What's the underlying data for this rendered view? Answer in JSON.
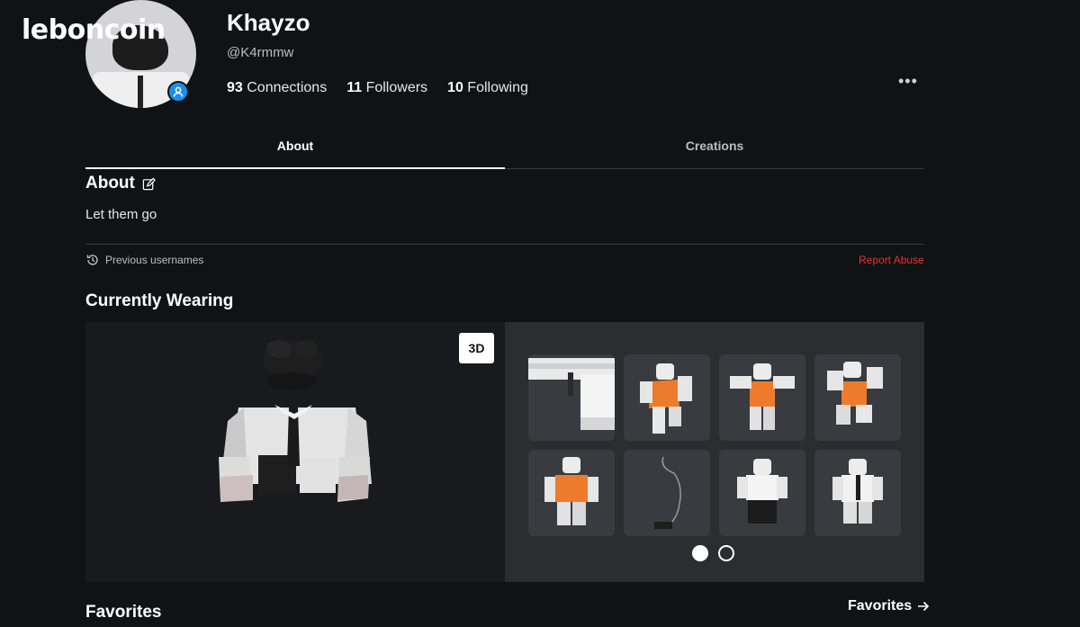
{
  "watermark": "leboncoin",
  "profile": {
    "display_name": "Khayzo",
    "handle": "@K4rmmw",
    "stats": [
      {
        "count": "93",
        "label": "Connections"
      },
      {
        "count": "11",
        "label": "Followers"
      },
      {
        "count": "10",
        "label": "Following"
      }
    ],
    "more_label": "•••"
  },
  "tabs": [
    {
      "label": "About",
      "active": true
    },
    {
      "label": "Creations",
      "active": false
    }
  ],
  "about": {
    "title": "About",
    "bio": "Let them go",
    "previous_usernames": "Previous usernames",
    "report": "Report Abuse"
  },
  "wearing": {
    "title": "Currently Wearing",
    "view_toggle": "3D",
    "items": [
      {
        "icon": "shirt-collar-item-icon"
      },
      {
        "icon": "orange-shirt-animation-icon"
      },
      {
        "icon": "orange-shirt-pose-icon"
      },
      {
        "icon": "orange-shirt-jump-icon"
      },
      {
        "icon": "orange-shirt-idle-icon"
      },
      {
        "icon": "necklace-item-icon"
      },
      {
        "icon": "white-shirt-black-pants-icon"
      },
      {
        "icon": "white-shirt-tie-icon"
      }
    ],
    "page_dots": [
      true,
      false
    ]
  },
  "favorites": {
    "title": "Favorites",
    "link": "Favorites"
  },
  "colors": {
    "background": "#111214",
    "panel": "#2b2d31",
    "accent_blue": "#1a8ff0",
    "report_red": "#e5322d"
  }
}
